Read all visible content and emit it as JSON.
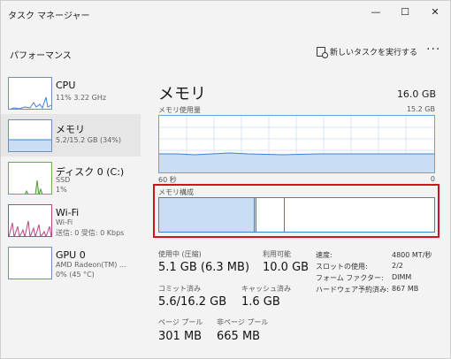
{
  "window": {
    "title": "タスク マネージャー",
    "controls": {
      "minimize": "—",
      "maximize": "☐",
      "close": "✕"
    }
  },
  "header": {
    "page_title": "パフォーマンス",
    "run_task_label": "新しいタスクを実行する",
    "more_label": "···"
  },
  "sidebar": {
    "items": [
      {
        "title": "CPU",
        "lines": [
          "11%  3.22 GHz"
        ]
      },
      {
        "title": "メモリ",
        "lines": [
          "5.2/15.2 GB (34%)"
        ]
      },
      {
        "title": "ディスク 0 (C:)",
        "lines": [
          "SSD",
          "1%"
        ]
      },
      {
        "title": "Wi-Fi",
        "lines": [
          "Wi-Fi",
          "送信: 0 受信: 0 Kbps"
        ]
      },
      {
        "title": "GPU 0",
        "lines": [
          "AMD Radeon(TM) ...",
          "0% (45 °C)"
        ]
      }
    ]
  },
  "main": {
    "title": "メモリ",
    "total": "16.0 GB",
    "usage_label": "メモリ使用量",
    "usage_max": "15.2 GB",
    "axis_left": "60 秒",
    "axis_right": "0",
    "composition_label": "メモリ構成",
    "stats": {
      "in_use_label": "使用中 (圧縮)",
      "in_use_value": "5.1 GB (6.3 MB)",
      "available_label": "利用可能",
      "available_value": "10.0 GB",
      "committed_label": "コミット済み",
      "committed_value": "5.6/16.2 GB",
      "cached_label": "キャッシュ済み",
      "cached_value": "1.6 GB",
      "paged_label": "ページ プール",
      "paged_value": "301 MB",
      "nonpaged_label": "非ページ プール",
      "nonpaged_value": "665 MB"
    },
    "specs": [
      {
        "label": "速度:",
        "value": "4800 MT/秒"
      },
      {
        "label": "スロットの使用:",
        "value": "2/2"
      },
      {
        "label": "フォーム ファクター:",
        "value": "DIMM"
      },
      {
        "label": "ハードウェア予約済み:",
        "value": "867 MB"
      }
    ]
  },
  "colors": {
    "accent": "#3f7fd0",
    "fill": "#c9ddf5",
    "highlight": "#d0141e",
    "disk_green": "#4f9a33",
    "wifi_magenta": "#b2487f"
  }
}
